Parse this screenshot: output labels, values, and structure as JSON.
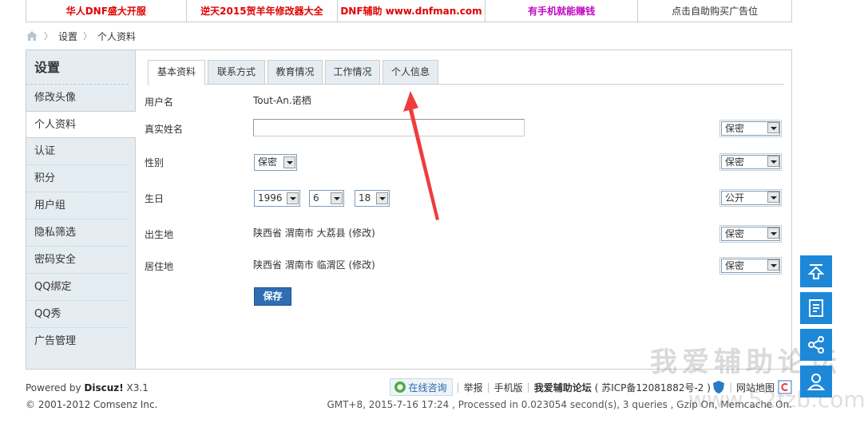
{
  "ads": [
    {
      "label": "华人DNF盛大开服",
      "color": "#e10000"
    },
    {
      "label": "逆天2015贺羊年修改器大全",
      "color": "#e10000"
    },
    {
      "label": "DNF辅助 www.dnfman.com",
      "color": "#e10000"
    },
    {
      "label": "有手机就能赚钱",
      "color": "#c10cc2"
    },
    {
      "label": "点击自助购买广告位",
      "color": "#333333"
    }
  ],
  "breadcrumb": {
    "items": [
      "设置",
      "个人资料"
    ]
  },
  "sidebar": {
    "title": "设置",
    "items": [
      "修改头像",
      "个人资料",
      "认证",
      "积分",
      "用户组",
      "隐私筛选",
      "密码安全",
      "QQ绑定",
      "QQ秀",
      "广告管理"
    ],
    "active_index": 1
  },
  "tabs": [
    "基本资料",
    "联系方式",
    "教育情况",
    "工作情况",
    "个人信息"
  ],
  "form": {
    "username_label": "用户名",
    "username_value": "Tout-An.诺栖",
    "realname_label": "真实姓名",
    "realname_value": "",
    "gender_label": "性别",
    "gender_value": "保密",
    "birthday_label": "生日",
    "birth_year": "1996",
    "birth_month": "6",
    "birth_day": "18",
    "birthplace_label": "出生地",
    "birthplace_value": "陕西省 渭南市 大荔县 (修改)",
    "residence_label": "居住地",
    "residence_value": "陕西省 渭南市 临渭区 (修改)",
    "privacy": [
      "保密",
      "保密",
      "公开",
      "保密",
      "保密"
    ],
    "save_label": "保存"
  },
  "footer": {
    "powered_prefix": "Powered by ",
    "powered_brand": "Discuz!",
    "powered_version": " X3.1",
    "copyright": "© 2001-2012 Comsenz Inc.",
    "consult_label": "在线咨询",
    "links": [
      "举报",
      "手机版"
    ],
    "site_name": "我爱辅助论坛",
    "icp": "( 苏ICP备12081882号-2 )",
    "sitemap": "网站地图",
    "stats": "GMT+8, 2015-7-16 17:24 , Processed in 0.023054 second(s), 3 queries , Gzip On, Memcache On."
  },
  "watermark": {
    "text": "我爱辅助论坛",
    "url": "www.52fzb.com"
  },
  "colors": {
    "accent": "#1e88d8",
    "arrow": "#f03c3c",
    "sidebar_bg": "#e5edf2",
    "save_btn": "#2e6eb4"
  }
}
